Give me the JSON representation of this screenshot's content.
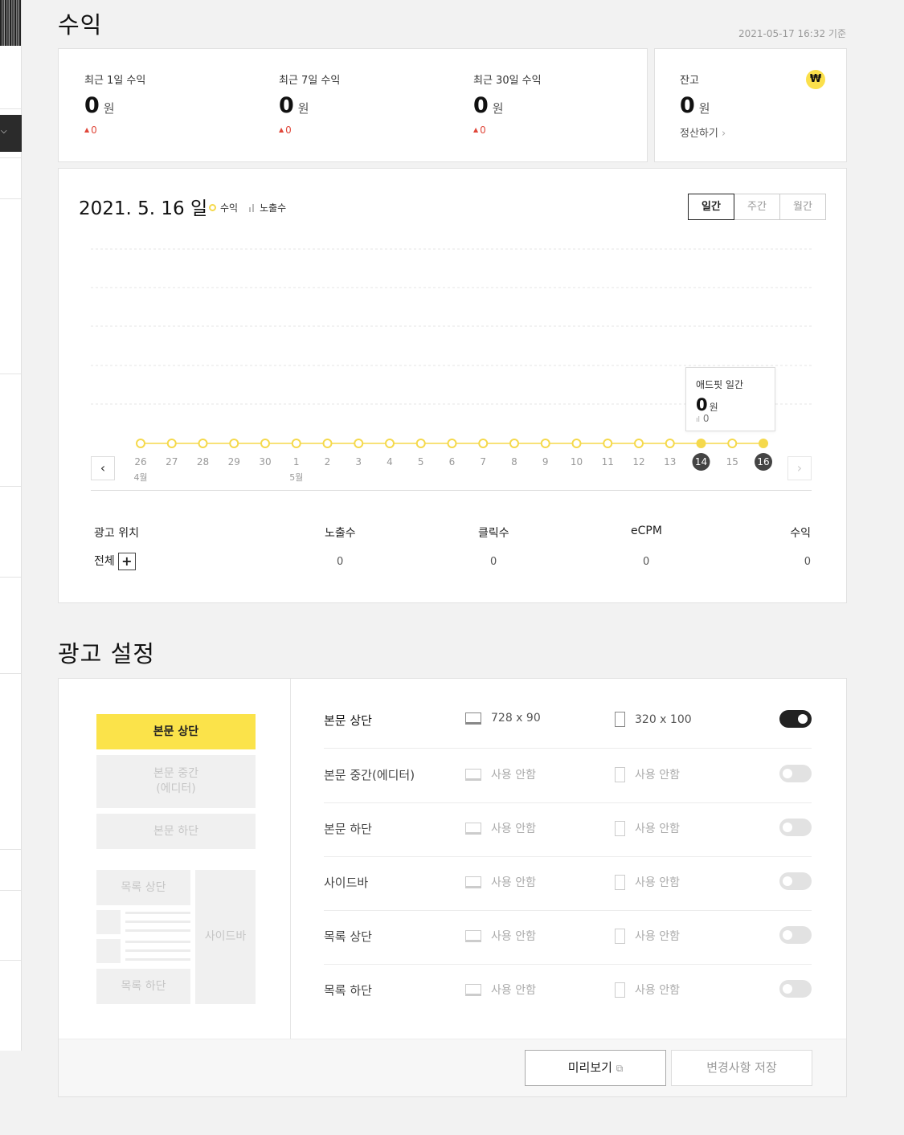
{
  "revenue": {
    "title": "수익",
    "timestamp": "2021-05-17 16:32 기준",
    "stats": [
      {
        "label": "최근 1일 수익",
        "value": "0",
        "unit": "원",
        "delta": "0"
      },
      {
        "label": "최근 7일 수익",
        "value": "0",
        "unit": "원",
        "delta": "0"
      },
      {
        "label": "최근 30일 수익",
        "value": "0",
        "unit": "원",
        "delta": "0"
      }
    ],
    "balance": {
      "label": "잔고",
      "value": "0",
      "unit": "원",
      "settle_link": "정산하기",
      "badge": "₩"
    }
  },
  "chart": {
    "date_title": "2021. 5. 16 일",
    "legend": {
      "revenue": "수익",
      "impressions": "노출수"
    },
    "period_tabs": [
      "일간",
      "주간",
      "월간"
    ],
    "active_period": "일간",
    "tooltip": {
      "title": "애드핏 일간",
      "value": "0",
      "unit": "원",
      "impressions": "0"
    },
    "month_labels": [
      {
        "label": "4월",
        "index": 0
      },
      {
        "label": "5월",
        "index": 5
      }
    ]
  },
  "chart_data": {
    "type": "line",
    "title": "",
    "x": [
      "26",
      "27",
      "28",
      "29",
      "30",
      "1",
      "2",
      "3",
      "4",
      "5",
      "6",
      "7",
      "8",
      "9",
      "10",
      "11",
      "12",
      "13",
      "14",
      "15",
      "16"
    ],
    "series": [
      {
        "name": "수익",
        "values": [
          0,
          0,
          0,
          0,
          0,
          0,
          0,
          0,
          0,
          0,
          0,
          0,
          0,
          0,
          0,
          0,
          0,
          0,
          0,
          0,
          0
        ]
      }
    ],
    "highlighted_x": [
      "14",
      "16"
    ],
    "grid": true,
    "colors": {
      "line": "#f5d94c",
      "highlight": "#444444"
    }
  },
  "table": {
    "headers": [
      "광고 위치",
      "노출수",
      "클릭수",
      "eCPM",
      "수익"
    ],
    "row": {
      "position": "전체",
      "impressions": "0",
      "clicks": "0",
      "ecpm": "0",
      "revenue": "0"
    },
    "expand_icon": "+"
  },
  "ad_settings": {
    "title": "광고 설정",
    "layout": {
      "top": "본문 상단",
      "middle_line1": "본문 중간",
      "middle_line2": "(에디터)",
      "bottom": "본문 하단",
      "list_top": "목록 상단",
      "list_bottom": "목록 하단",
      "sidebar": "사이드바"
    },
    "rows": [
      {
        "name": "본문 상단",
        "pc": "728 x 90",
        "mobile": "320 x 100",
        "enabled": true
      },
      {
        "name": "본문 중간(에디터)",
        "pc": "사용 안함",
        "mobile": "사용 안함",
        "enabled": false
      },
      {
        "name": "본문 하단",
        "pc": "사용 안함",
        "mobile": "사용 안함",
        "enabled": false
      },
      {
        "name": "사이드바",
        "pc": "사용 안함",
        "mobile": "사용 안함",
        "enabled": false
      },
      {
        "name": "목록 상단",
        "pc": "사용 안함",
        "mobile": "사용 안함",
        "enabled": false
      },
      {
        "name": "목록 하단",
        "pc": "사용 안함",
        "mobile": "사용 안함",
        "enabled": false
      }
    ],
    "preview_button": "미리보기",
    "save_button": "변경사항 저장"
  },
  "colors": {
    "accent": "#fbe34a",
    "delta": "#e0473a"
  }
}
